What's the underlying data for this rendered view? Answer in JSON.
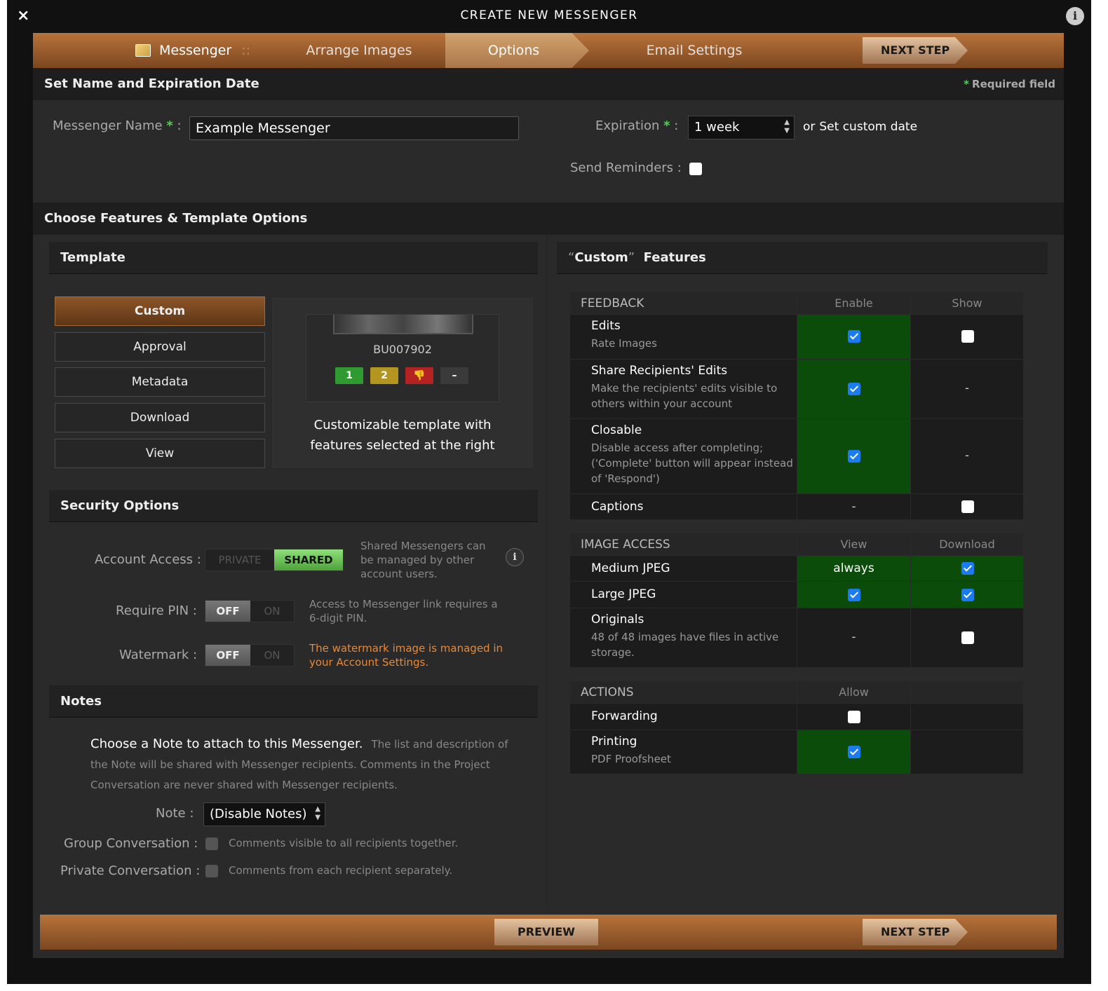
{
  "window": {
    "title": "CREATE NEW MESSENGER",
    "close_glyph": "×",
    "info_glyph": "i"
  },
  "steps": {
    "messenger": "Messenger",
    "separator": "::",
    "arrange": "Arrange Images",
    "options": "Options",
    "email": "Email Settings",
    "next_step": "NEXT STEP"
  },
  "section_name": {
    "title": "Set Name and Expiration Date",
    "required_star": "*",
    "required_label": "Required field"
  },
  "name_field": {
    "label": "Messenger Name",
    "star": "*",
    "colon": ":",
    "value": "Example Messenger"
  },
  "expiration": {
    "label": "Expiration",
    "star": "*",
    "colon": ":",
    "value": "1 week",
    "or": "or",
    "custom_date": "Set custom date"
  },
  "reminders": {
    "label": "Send Reminders :",
    "checked": false
  },
  "section_features": {
    "title": "Choose Features & Template Options"
  },
  "template": {
    "title": "Template",
    "buttons": [
      "Custom",
      "Approval",
      "Metadata",
      "Download",
      "View"
    ],
    "active": "Custom",
    "preview": {
      "image_id": "BU007902",
      "rating_1": "1",
      "rating_2": "2",
      "reject_icon": "👎",
      "clear": "–",
      "description_line1": "Customizable template with",
      "description_line2": "features selected at the right"
    }
  },
  "security": {
    "title": "Security Options",
    "account_access": {
      "label": "Account Access :",
      "private": "PRIVATE",
      "shared": "SHARED",
      "hint_line1": "Shared Messengers can",
      "hint_line2": "be managed by other",
      "hint_line3": "account users."
    },
    "require_pin": {
      "label": "Require PIN :",
      "off": "OFF",
      "on": "ON",
      "hint_line1": "Access to Messenger link requires a",
      "hint_line2": "6-digit PIN."
    },
    "watermark": {
      "label": "Watermark :",
      "off": "OFF",
      "on": "ON",
      "hint_line1": "The watermark image is managed in",
      "hint_line2": "your Account Settings."
    },
    "info_glyph": "i"
  },
  "notes": {
    "title": "Notes",
    "intro_strong": "Choose a Note to attach to this Messenger.",
    "intro_rest": "The list and description of the Note will be shared with Messenger recipients. Comments in the Project Conversation are never shared with Messenger recipients.",
    "note_label": "Note :",
    "note_value": "(Disable Notes)",
    "group_label": "Group Conversation :",
    "group_desc": "Comments visible to all recipients together.",
    "private_label": "Private Conversation :",
    "private_desc": "Comments from each recipient separately."
  },
  "custom_features": {
    "title_quote_open": "“",
    "title_name": "Custom",
    "title_quote_close": "”",
    "title_rest": "Features",
    "feedback": {
      "header": "FEEDBACK",
      "col_enable": "Enable",
      "col_show": "Show",
      "edits": {
        "title": "Edits",
        "sub": "Rate Images"
      },
      "share": {
        "title": "Share Recipients' Edits",
        "sub_line1": "Make the recipients' edits visible to",
        "sub_line2": "others within your account",
        "show": "-"
      },
      "closable": {
        "title": "Closable",
        "sub_line1": "Disable access after completing;",
        "sub_line2": "('Complete' button will appear instead",
        "sub_line3": "of 'Respond')",
        "show": "-"
      },
      "captions": {
        "title": "Captions",
        "enable": "-"
      }
    },
    "image_access": {
      "header": "IMAGE ACCESS",
      "col_view": "View",
      "col_download": "Download",
      "medium": {
        "title": "Medium JPEG",
        "view": "always"
      },
      "large": {
        "title": "Large JPEG"
      },
      "originals": {
        "title": "Originals",
        "sub_line1": "48 of 48 images have files in active",
        "sub_line2": "storage.",
        "view": "-"
      }
    },
    "actions": {
      "header": "ACTIONS",
      "col_allow": "Allow",
      "forwarding": {
        "title": "Forwarding"
      },
      "printing": {
        "title": "Printing",
        "sub": "PDF Proofsheet"
      }
    }
  },
  "bottom": {
    "preview": "PREVIEW",
    "next_step": "NEXT STEP"
  },
  "colors": {
    "accent_orange": "#b8733a",
    "enabled_green": "#0b4c0b",
    "shared_green": "#6bc35a",
    "checkbox_blue": "#1a7cf0",
    "warning_orange": "#e68a3a"
  }
}
